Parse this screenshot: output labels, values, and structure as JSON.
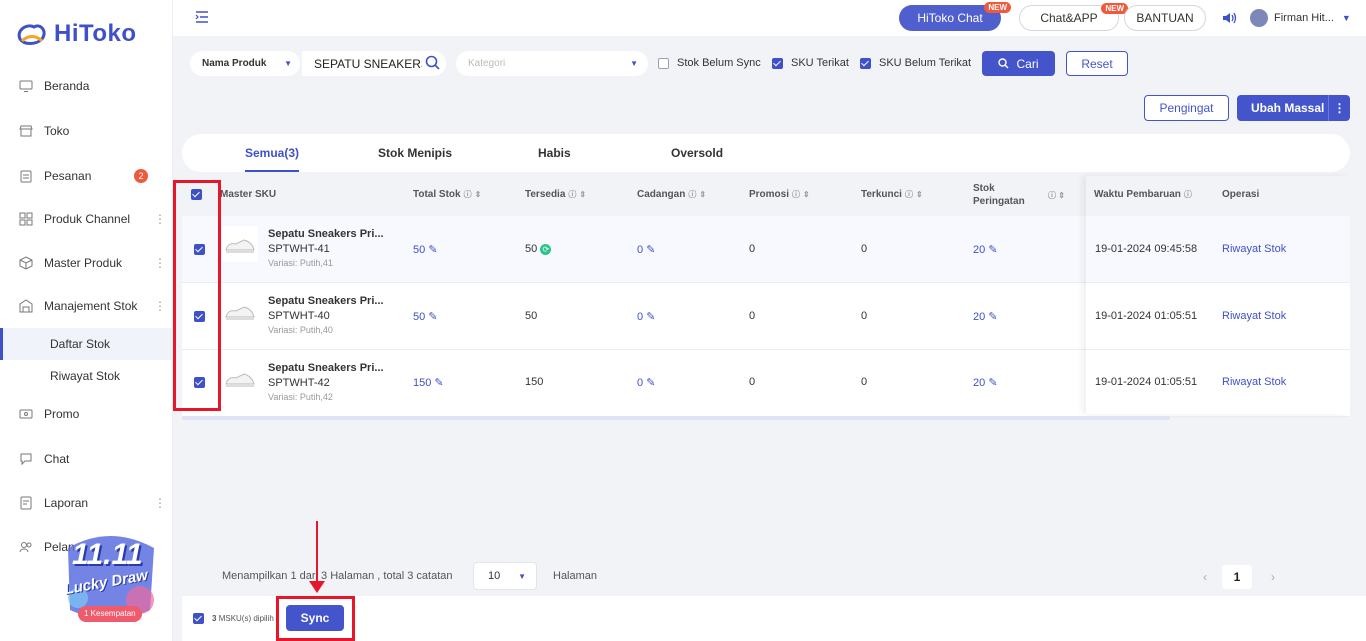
{
  "brand": {
    "name": "HiToko",
    "accent": "#3f51c8"
  },
  "sidebar": {
    "items": [
      {
        "label": "Beranda",
        "icon": "monitor-icon"
      },
      {
        "label": "Toko",
        "icon": "store-icon"
      },
      {
        "label": "Pesanan",
        "icon": "clipboard-icon",
        "badge": "2"
      },
      {
        "label": "Produk Channel",
        "icon": "grid-icon"
      },
      {
        "label": "Master Produk",
        "icon": "box-icon"
      },
      {
        "label": "Manajement Stok",
        "icon": "warehouse-icon"
      },
      {
        "label": "Promo",
        "icon": "ticket-icon"
      },
      {
        "label": "Chat",
        "icon": "chat-icon"
      },
      {
        "label": "Laporan",
        "icon": "report-icon"
      },
      {
        "label": "Pelan",
        "icon": "users-icon"
      }
    ],
    "sub_items": [
      {
        "label": "Daftar Stok"
      },
      {
        "label": "Riwayat Stok"
      }
    ],
    "promo": {
      "title": "11.11",
      "subtitle": "Lucky Draw",
      "chance": "1 Kesempatan"
    }
  },
  "topbar": {
    "hitoko_chat": "HiToko Chat",
    "chat_app": "Chat&APP",
    "bantuan": "BANTUAN",
    "new_tag": "NEW",
    "user_name": "Firman Hit..."
  },
  "filters": {
    "product_type": "Nama Produk",
    "search_value": "SEPATU SNEAKERS",
    "category_placeholder": "Kategori",
    "stok_belum_sync": "Stok Belum Sync",
    "sku_terikat": "SKU Terikat",
    "sku_belum_terikat": "SKU Belum Terikat",
    "cari": "Cari",
    "reset": "Reset",
    "pengingat": "Pengingat",
    "ubah_massal": "Ubah Massal"
  },
  "tabs": [
    {
      "label": "Semua(3)"
    },
    {
      "label": "Stok Menipis"
    },
    {
      "label": "Habis"
    },
    {
      "label": "Oversold"
    }
  ],
  "table": {
    "headers": {
      "master_sku": "Master SKU",
      "total_stok": "Total Stok",
      "tersedia": "Tersedia",
      "cadangan": "Cadangan",
      "promosi": "Promosi",
      "terkunci": "Terkunci",
      "stok_peringatan_1": "Stok",
      "stok_peringatan_2": "Peringatan",
      "waktu": "Waktu Pembaruan",
      "operasi": "Operasi"
    },
    "rows": [
      {
        "name": "Sepatu Sneakers Pri...",
        "sku": "SPTWHT-41",
        "variant": "Variasi: Putih,41",
        "total": "50",
        "tersedia": "50",
        "cadangan": "0",
        "promosi": "0",
        "terkunci": "0",
        "peringatan": "20",
        "waktu": "19-01-2024 09:45:58",
        "operasi": "Riwayat Stok"
      },
      {
        "name": "Sepatu Sneakers Pri...",
        "sku": "SPTWHT-40",
        "variant": "Variasi: Putih,40",
        "total": "50",
        "tersedia": "50",
        "cadangan": "0",
        "promosi": "0",
        "terkunci": "0",
        "peringatan": "20",
        "waktu": "19-01-2024 01:05:51",
        "operasi": "Riwayat Stok"
      },
      {
        "name": "Sepatu Sneakers Pri...",
        "sku": "SPTWHT-42",
        "variant": "Variasi: Putih,42",
        "total": "150",
        "tersedia": "150",
        "cadangan": "0",
        "promosi": "0",
        "terkunci": "0",
        "peringatan": "20",
        "waktu": "19-01-2024 01:05:51",
        "operasi": "Riwayat Stok"
      }
    ]
  },
  "pagination": {
    "summary": "Menampilkan 1 dari 3 Halaman , total 3 catatan",
    "page_size": "10",
    "halaman": "Halaman",
    "current_page": "1",
    "prev": "‹",
    "next": "›"
  },
  "bottom": {
    "selected_count": "3",
    "selected_label": "MSKU(s) dipilih",
    "sync": "Sync"
  }
}
